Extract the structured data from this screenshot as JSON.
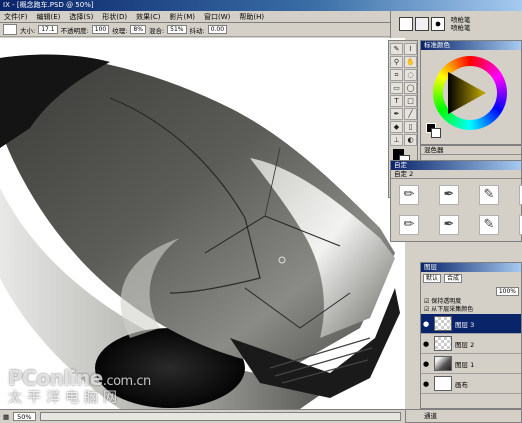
{
  "window": {
    "title": "IX - [概念跑车.PSD @ 50%]"
  },
  "menu": [
    "文件(F)",
    "编辑(E)",
    "选择(S)",
    "形状(D)",
    "效果(C)",
    "影片(M)",
    "窗口(W)",
    "帮助(H)"
  ],
  "options": {
    "size_label": "大小:",
    "size_value": "17.1",
    "opacity_label": "不透明度:",
    "opacity_value": "100",
    "grain_label": "纹理:",
    "grain_value": "8%",
    "blend_label": "混合:",
    "blend_value": "51%",
    "jitter_label": "抖动:",
    "jitter_value": "0.00"
  },
  "brush_names": {
    "line1": "喷枪笔",
    "line2": "喷枪笔"
  },
  "panels": {
    "color": "标准颜色",
    "mixer": "混色器",
    "brushes": "自定",
    "brushes_sub": "自定  2",
    "layers": "图层",
    "channels": "通道"
  },
  "layers_panel": {
    "composite": "默认",
    "composite_method": "合成",
    "opacity": "100%",
    "checkbox1": "保持透明度",
    "checkbox2": "从下层采集颜色",
    "rows": [
      {
        "name": "图层 3",
        "selected": true
      },
      {
        "name": "图层 2",
        "selected": false
      },
      {
        "name": "图层 1",
        "selected": false
      },
      {
        "name": "画布",
        "selected": false
      }
    ]
  },
  "status": {
    "zoom": "50%"
  },
  "watermark": {
    "brand": "PConline",
    "brand_suffix": ".com.cn",
    "cn": "太平洋电脑网"
  },
  "colors": {
    "titlebar": "#0a246a",
    "panel_bg": "#d4d0c8",
    "selected_layer": "#0a246a"
  }
}
